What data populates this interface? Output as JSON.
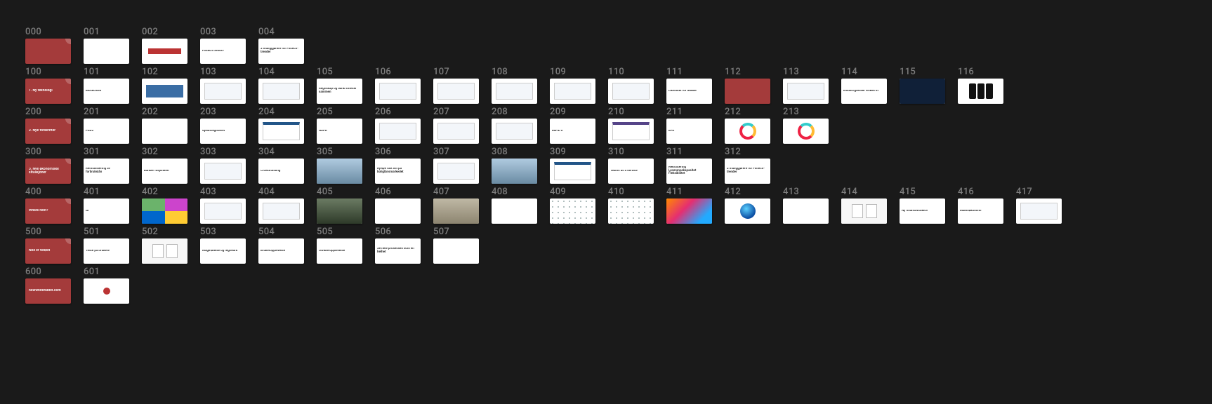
{
  "rows": [
    {
      "cells": [
        {
          "num": "000",
          "variant": "red corner",
          "content": ""
        },
        {
          "num": "001",
          "variant": "white",
          "content": ""
        },
        {
          "num": "002",
          "variant": "white",
          "content": "",
          "graphic": "redstrip"
        },
        {
          "num": "003",
          "variant": "white",
          "content": "Fintech trends?"
        },
        {
          "num": "004",
          "variant": "white",
          "content": "3 muliggjørere for Fintech-trender"
        }
      ]
    },
    {
      "cells": [
        {
          "num": "100",
          "variant": "red corner",
          "content": "1. Ny teknologi"
        },
        {
          "num": "101",
          "variant": "white",
          "content": "Blockchain"
        },
        {
          "num": "102",
          "variant": "white",
          "graphic": "bar"
        },
        {
          "num": "103",
          "variant": "white",
          "graphic": "bord"
        },
        {
          "num": "104",
          "variant": "white",
          "graphic": "bord"
        },
        {
          "num": "105",
          "variant": "white",
          "content": "Regnskap og bank smelter sammen"
        },
        {
          "num": "106",
          "variant": "white",
          "graphic": "bord"
        },
        {
          "num": "107",
          "variant": "white",
          "graphic": "bord"
        },
        {
          "num": "108",
          "variant": "white",
          "graphic": "bord"
        },
        {
          "num": "109",
          "variant": "white",
          "graphic": "bord"
        },
        {
          "num": "110",
          "variant": "white",
          "graphic": "bord"
        },
        {
          "num": "111",
          "variant": "white",
          "content": "Likviditet for SMBer"
        },
        {
          "num": "112",
          "variant": "red",
          "content": ""
        },
        {
          "num": "113",
          "variant": "white",
          "graphic": "bord"
        },
        {
          "num": "114",
          "variant": "white",
          "content": "Industrigrenser viskes ut"
        },
        {
          "num": "115",
          "variant": "white",
          "graphic": "dark-screen"
        },
        {
          "num": "116",
          "variant": "white",
          "graphic": "phone-row"
        }
      ]
    },
    {
      "cells": [
        {
          "num": "200",
          "variant": "red corner",
          "content": "2. Nye forskrifter"
        },
        {
          "num": "201",
          "variant": "white",
          "content": "PSD2"
        },
        {
          "num": "202",
          "variant": "white",
          "content": ""
        },
        {
          "num": "203",
          "variant": "white",
          "content": "Gjeldsregisteret"
        },
        {
          "num": "204",
          "variant": "white",
          "graphic": "screen-ui blue"
        },
        {
          "num": "205",
          "variant": "white",
          "content": "GDPR"
        },
        {
          "num": "206",
          "variant": "white",
          "graphic": "bord"
        },
        {
          "num": "207",
          "variant": "white",
          "graphic": "bord"
        },
        {
          "num": "208",
          "variant": "white",
          "graphic": "bord"
        },
        {
          "num": "209",
          "variant": "white",
          "content": "MiFID II"
        },
        {
          "num": "210",
          "variant": "white",
          "graphic": "screen-ui purple"
        },
        {
          "num": "211",
          "variant": "white",
          "content": "EPK"
        },
        {
          "num": "212",
          "variant": "white",
          "graphic": "donut"
        },
        {
          "num": "213",
          "variant": "white",
          "graphic": "donut"
        }
      ]
    },
    {
      "cells": [
        {
          "num": "300",
          "variant": "red corner",
          "content": "3. Nye økonomiske situasjoner"
        },
        {
          "num": "301",
          "variant": "white",
          "content": "Refinansiering av forbrukslån"
        },
        {
          "num": "302",
          "variant": "white",
          "content": "Banker fusjonerer"
        },
        {
          "num": "303",
          "variant": "white",
          "graphic": "bord"
        },
        {
          "num": "304",
          "variant": "white",
          "content": "Crowdfunding"
        },
        {
          "num": "305",
          "variant": "white",
          "graphic": "photo3"
        },
        {
          "num": "306",
          "variant": "white",
          "content": "Hjelpe folk inn på boliglånsmarkedet"
        },
        {
          "num": "307",
          "variant": "white",
          "graphic": "bord"
        },
        {
          "num": "308",
          "variant": "white",
          "graphic": "photo3"
        },
        {
          "num": "309",
          "variant": "white",
          "graphic": "screen-ui blue"
        },
        {
          "num": "310",
          "variant": "white",
          "content": "Teams as a service"
        },
        {
          "num": "311",
          "variant": "white",
          "content": "Rekruttering Leveransekapasitet Fleksibilitet"
        },
        {
          "num": "312",
          "variant": "white",
          "content": "3 muliggjørere for Fintech-trender"
        }
      ]
    },
    {
      "cells": [
        {
          "num": "400",
          "variant": "red corner",
          "content": "Whats next?"
        },
        {
          "num": "401",
          "variant": "white",
          "content": "AI"
        },
        {
          "num": "402",
          "variant": "white",
          "graphic": "collage"
        },
        {
          "num": "403",
          "variant": "white",
          "graphic": "bord"
        },
        {
          "num": "404",
          "variant": "white",
          "graphic": "bord"
        },
        {
          "num": "405",
          "variant": "white",
          "graphic": "photo1"
        },
        {
          "num": "406",
          "variant": "white",
          "content": ""
        },
        {
          "num": "407",
          "variant": "white",
          "graphic": "photo2"
        },
        {
          "num": "408",
          "variant": "white",
          "content": ""
        },
        {
          "num": "409",
          "variant": "white",
          "graphic": "grid-dots"
        },
        {
          "num": "410",
          "variant": "white",
          "graphic": "grid-dots"
        },
        {
          "num": "411",
          "variant": "white",
          "graphic": "abstract"
        },
        {
          "num": "412",
          "variant": "white",
          "graphic": "circle-blob"
        },
        {
          "num": "413",
          "variant": "white",
          "content": ""
        },
        {
          "num": "414",
          "variant": "white",
          "graphic": "pair"
        },
        {
          "num": "415",
          "variant": "white",
          "content": "Ny finansavtalelov"
        },
        {
          "num": "416",
          "variant": "white",
          "content": "Makroøkonomi"
        },
        {
          "num": "417",
          "variant": "white",
          "graphic": "bord"
        }
      ]
    },
    {
      "cells": [
        {
          "num": "500",
          "variant": "red corner",
          "content": "Noe er tidløst"
        },
        {
          "num": "501",
          "variant": "white",
          "content": "Teste på brukere"
        },
        {
          "num": "502",
          "variant": "white",
          "graphic": "pair"
        },
        {
          "num": "503",
          "variant": "white",
          "content": "Magefølelse og regneark"
        },
        {
          "num": "504",
          "variant": "white",
          "content": "Brukeropplevelse"
        },
        {
          "num": "505",
          "variant": "white",
          "content": "Utvikleropplevelse"
        },
        {
          "num": "506",
          "variant": "white",
          "content": "Se hele prosessen som en helhet"
        },
        {
          "num": "507",
          "variant": "white",
          "content": ""
        }
      ]
    },
    {
      "cells": [
        {
          "num": "600",
          "variant": "red",
          "content": "nowwhiterabbit.com"
        },
        {
          "num": "601",
          "variant": "white",
          "graphic": "logo-dot"
        }
      ]
    }
  ]
}
